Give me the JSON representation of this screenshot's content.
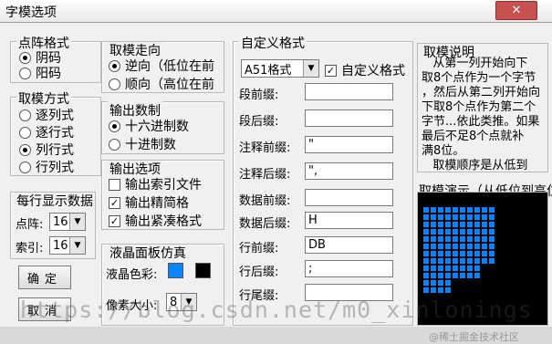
{
  "window": {
    "title": "字模选项",
    "close_glyph": "✕"
  },
  "dot_format": {
    "title": "点阵格式",
    "options": [
      {
        "label": "阴码",
        "selected": true
      },
      {
        "label": "阳码",
        "selected": false
      }
    ]
  },
  "mode": {
    "title": "取模方式",
    "options": [
      {
        "label": "逐列式",
        "selected": false
      },
      {
        "label": "逐行式",
        "selected": false
      },
      {
        "label": "列行式",
        "selected": true
      },
      {
        "label": "行列式",
        "selected": false
      }
    ]
  },
  "per_line": {
    "title": "每行显示数据",
    "dots_label": "点阵:",
    "dots_value": "16",
    "index_label": "索引:",
    "index_value": "16"
  },
  "buttons": {
    "ok": "确定",
    "cancel": "取消"
  },
  "direction": {
    "title": "取模走向",
    "options": [
      {
        "label": "逆向（低位在前",
        "selected": true
      },
      {
        "label": "顺向（高位在前",
        "selected": false
      }
    ]
  },
  "output_base": {
    "title": "输出数制",
    "options": [
      {
        "label": "十六进制数",
        "selected": true
      },
      {
        "label": "十进制数",
        "selected": false
      }
    ]
  },
  "output_options": {
    "title": "输出选项",
    "options": [
      {
        "label": "输出索引文件",
        "checked": false
      },
      {
        "label": "输出精简格",
        "checked": true
      },
      {
        "label": "输出紧凑格式",
        "checked": true
      }
    ]
  },
  "lcd": {
    "title": "液晶面板仿真",
    "color_label": "液晶色彩:",
    "color_on": "#0a84ff",
    "color_off": "#000000",
    "size_label": "像素大小:",
    "size_value": "8"
  },
  "custom": {
    "title": "自定义格式",
    "format_value": "A51格式",
    "custom_check_label": "自定义格式",
    "custom_checked": true,
    "fields": [
      {
        "label": "段前缀:",
        "value": ""
      },
      {
        "label": "段后缀:",
        "value": ""
      },
      {
        "label": "注释前缀:",
        "value": "\""
      },
      {
        "label": "注释后缀:",
        "value": "\","
      },
      {
        "label": "数据前缀:",
        "value": ""
      },
      {
        "label": "数据后缀:",
        "value": "H"
      },
      {
        "label": "行前缀:",
        "value": "DB"
      },
      {
        "label": "行后缀:",
        "value": ";"
      },
      {
        "label": "行尾缀:",
        "value": ""
      }
    ]
  },
  "description": {
    "title": "取模说明",
    "text": "   从第一列开始向下\n取8个点作为一个字节\n，然后从第二列开始向\n下取8个点作为第二个\n字节...依此类推。如果\n最后不足8个点就补\n满8位。\n   取模顺序是从低到"
  },
  "demo": {
    "title": "取模演示（从低位到高位）"
  },
  "watermark": {
    "text": "https://blog.csdn.net/m0_xinlonings",
    "corner": "@稀土掘金技术社区"
  }
}
